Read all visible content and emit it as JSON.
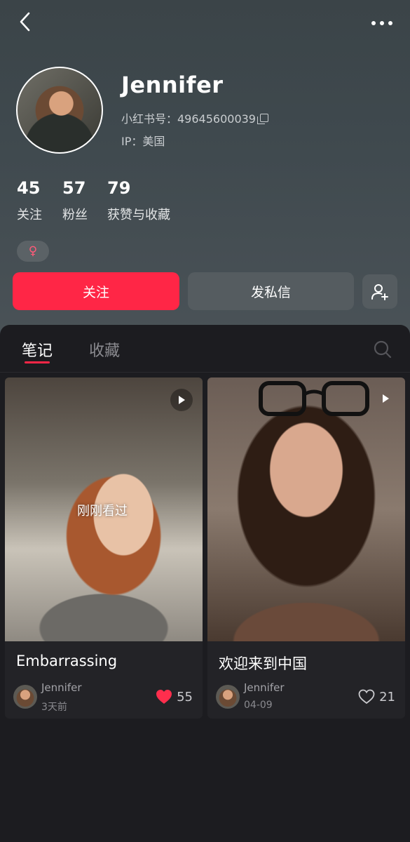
{
  "profile": {
    "name": "Jennifer",
    "id_text": "小红书号：49645600039",
    "ip_text": "IP：美国",
    "gender_symbol": "♀"
  },
  "stats": [
    {
      "value": "45",
      "label": "关注"
    },
    {
      "value": "57",
      "label": "粉丝"
    },
    {
      "value": "79",
      "label": "获赞与收藏"
    }
  ],
  "actions": {
    "follow_label": "关注",
    "message_label": "发私信"
  },
  "tabs": [
    {
      "label": "笔记",
      "active": true
    },
    {
      "label": "收藏",
      "active": false
    }
  ],
  "notes": [
    {
      "overlay_text": "刚刚看过",
      "title": "Embarrassing",
      "author": "Jennifer",
      "date": "3天前",
      "likes": "55",
      "liked": true
    },
    {
      "title": "欢迎来到中国",
      "author": "Jennifer",
      "date": "04-09",
      "likes": "21",
      "liked": false
    }
  ],
  "colors": {
    "accent": "#ff2646",
    "header_bg": "#3f494e",
    "panel_bg": "#1c1c20"
  },
  "icons": [
    "back-icon",
    "more-icon",
    "copy-icon",
    "female-icon",
    "add-user-icon",
    "search-icon",
    "play-icon",
    "heart-icon"
  ]
}
